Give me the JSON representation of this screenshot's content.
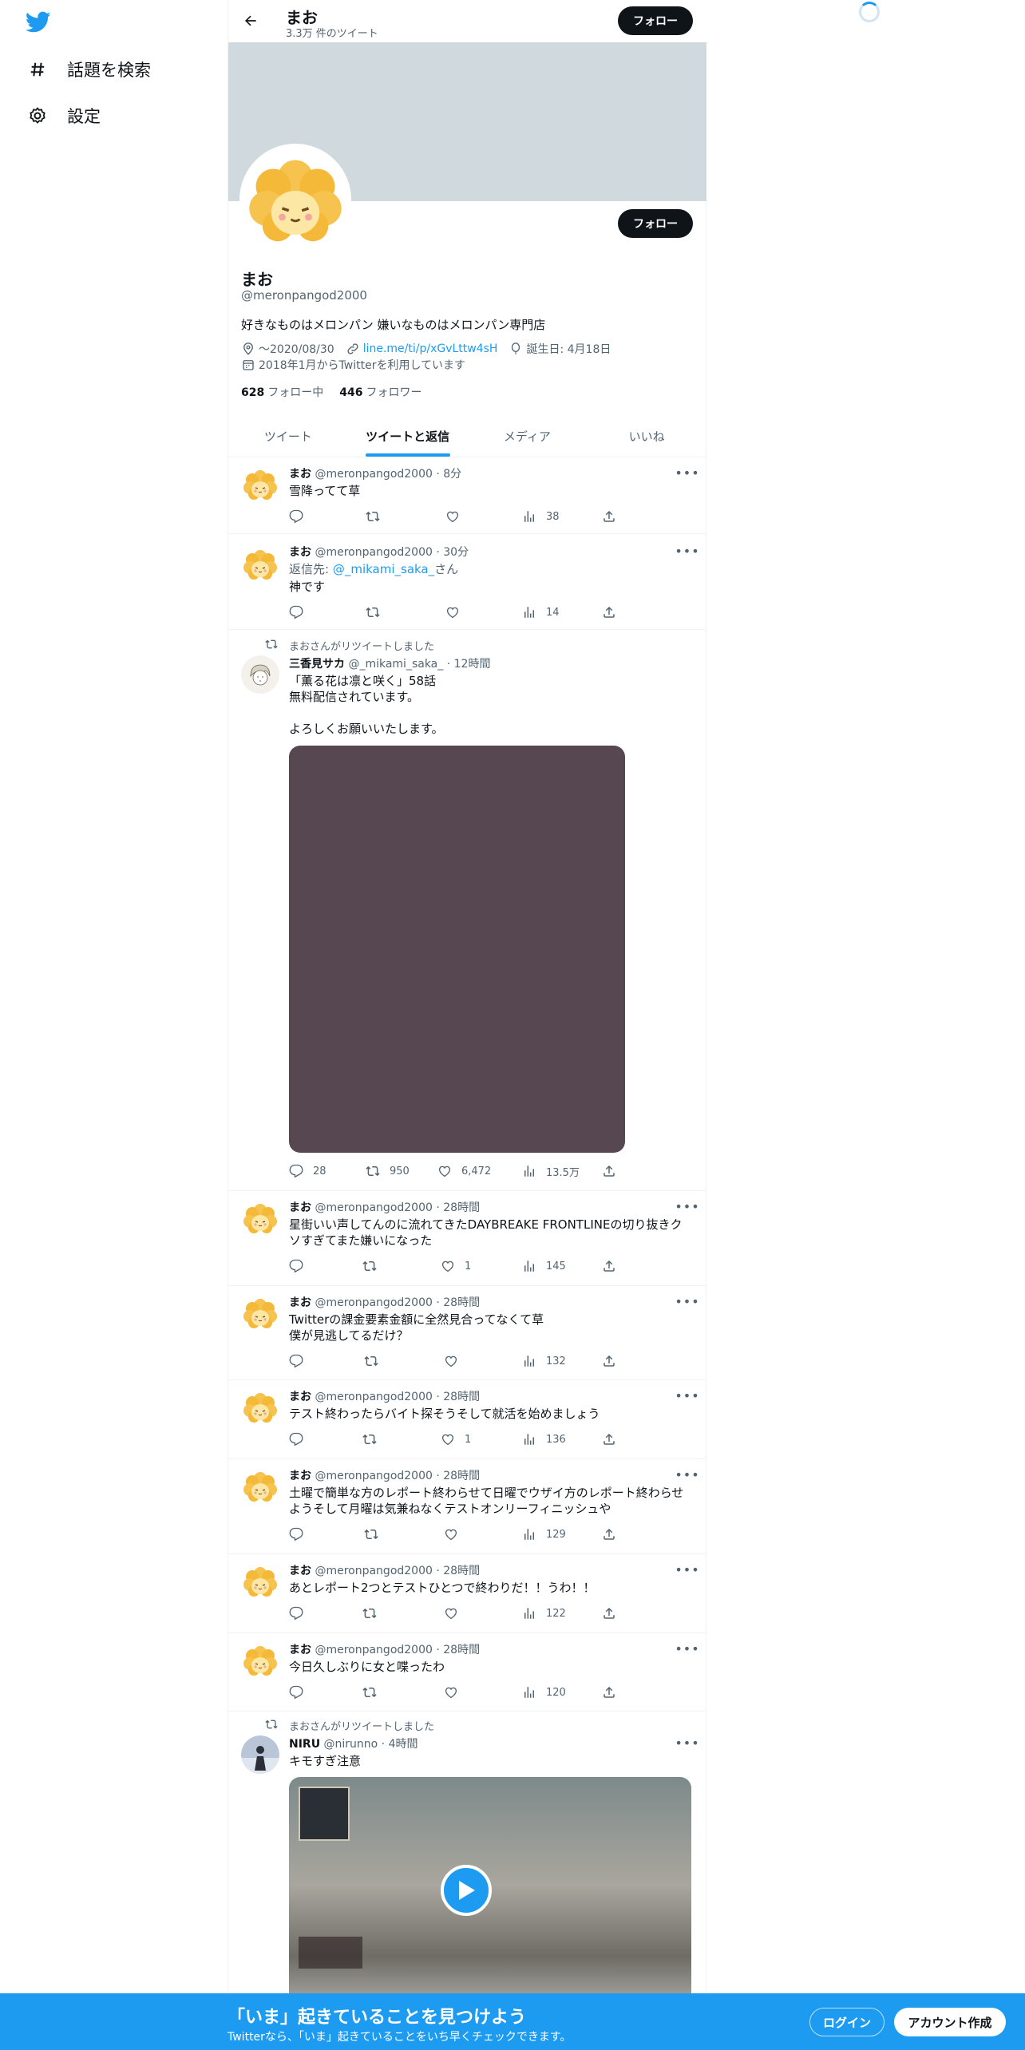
{
  "nav": {
    "items": [
      {
        "label": "話題を検索",
        "icon": "hashtag-icon"
      },
      {
        "label": "設定",
        "icon": "gear-icon"
      }
    ]
  },
  "header": {
    "name": "まお",
    "tweet_count": "3.3万 件のツイート",
    "follow_label": "フォロー"
  },
  "profile": {
    "name": "まお",
    "handle": "@meronpangod2000",
    "bio": "好きなものはメロンパン 嫌いなものはメロンパン専門店",
    "location": "〜2020/08/30",
    "url": "line.me/ti/p/xGvLttw4sH",
    "birthday": "誕生日: 4月18日",
    "joined": "2018年1月からTwitterを利用しています",
    "following_count": "628",
    "following_label": "フォロー中",
    "followers_count": "446",
    "followers_label": "フォロワー",
    "follow_label": "フォロー"
  },
  "tabs": [
    {
      "label": "ツイート",
      "active": false
    },
    {
      "label": "ツイートと返信",
      "active": true
    },
    {
      "label": "メディア",
      "active": false
    },
    {
      "label": "いいね",
      "active": false
    }
  ],
  "tweets": [
    {
      "name": "まお",
      "handle": "@meronpangod2000",
      "time": "8分",
      "text": "雪降ってて草",
      "replies": "",
      "retweets": "",
      "likes": "",
      "views": "38"
    },
    {
      "name": "まお",
      "handle": "@meronpangod2000",
      "time": "30分",
      "reply_to_prefix": "返信先: ",
      "reply_to": "@_mikami_saka_",
      "reply_to_suffix": "さん",
      "text": "神です",
      "replies": "",
      "retweets": "",
      "likes": "",
      "views": "14"
    },
    {
      "retweeted_by": "まおさんがリツイートしました",
      "name": "三香見サカ",
      "handle": "@_mikami_saka_",
      "time": "12時間",
      "text_lines": [
        "「薫る花は凛と咲く」58話",
        "無料配信されています。",
        "",
        "よろしくお願いいたします。"
      ],
      "replies": "28",
      "retweets": "950",
      "likes": "6,472",
      "views": "13.5万"
    },
    {
      "name": "まお",
      "handle": "@meronpangod2000",
      "time": "28時間",
      "text_lines": [
        "星街いい声してんのに流れてきたDAYBREAKE FRONTLINEの切り抜きク",
        "ソすぎてまた嫌いになった"
      ],
      "replies": "",
      "retweets": "",
      "likes": "1",
      "views": "145"
    },
    {
      "name": "まお",
      "handle": "@meronpangod2000",
      "time": "28時間",
      "text_lines": [
        "Twitterの課金要素金額に全然見合ってなくて草",
        "僕が見逃してるだけ？"
      ],
      "replies": "",
      "retweets": "",
      "likes": "",
      "views": "132"
    },
    {
      "name": "まお",
      "handle": "@meronpangod2000",
      "time": "28時間",
      "text": "テスト終わったらバイト探そうそして就活を始めましょう",
      "replies": "",
      "retweets": "",
      "likes": "1",
      "views": "136"
    },
    {
      "name": "まお",
      "handle": "@meronpangod2000",
      "time": "28時間",
      "text_lines": [
        "土曜で簡単な方のレポート終わらせて日曜でウザイ方のレポート終わらせ",
        "ようそして月曜は気兼ねなくテストオンリーフィニッシュや"
      ],
      "replies": "",
      "retweets": "",
      "likes": "",
      "views": "129"
    },
    {
      "name": "まお",
      "handle": "@meronpangod2000",
      "time": "28時間",
      "text": "あとレポート2つとテストひとつで終わりだ！！うわ！！",
      "replies": "",
      "retweets": "",
      "likes": "",
      "views": "122"
    },
    {
      "name": "まお",
      "handle": "@meronpangod2000",
      "time": "28時間",
      "text": "今日久しぶりに女と喋ったわ",
      "replies": "",
      "retweets": "",
      "likes": "",
      "views": "120"
    },
    {
      "retweeted_by": "まおさんがリツイートしました",
      "name": "NIRU",
      "handle": "@nirunno",
      "time": "4時間",
      "text": "キモすぎ注意"
    }
  ],
  "bottom_bar": {
    "title": "「いま」起きていることを見つけよう",
    "subtitle": "Twitterなら、「いま」起きていることをいち早くチェックできます。",
    "login_label": "ログイン",
    "signup_label": "アカウント作成"
  },
  "colors": {
    "accent": "#1d9bf0",
    "banner": "#cfd9de",
    "text": "#0f1419",
    "muted": "#536471"
  }
}
